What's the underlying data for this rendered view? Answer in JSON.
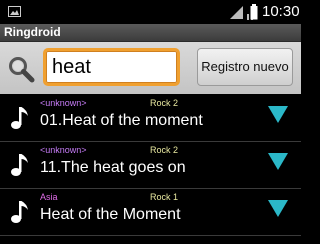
{
  "status_bar": {
    "time": "10:30",
    "icons": [
      "image-icon",
      "wifi-icon",
      "signal-icon",
      "battery-icon"
    ]
  },
  "app": {
    "title": "Ringdroid"
  },
  "search": {
    "value": "heat",
    "icon": "search-icon"
  },
  "buttons": {
    "new_label": "Registro nuevo"
  },
  "colors": {
    "artist_unknown": "#c67cf7",
    "artist_known": "#e06ce8",
    "album": "#e8e8a0",
    "menu_triangle": "#2bb8c8",
    "search_focus": "#f0a030"
  },
  "rows": [
    {
      "artist": "<unknown>",
      "album": "Rock 2",
      "title": "01.Heat of the moment"
    },
    {
      "artist": "<unknown>",
      "album": "Rock 2",
      "title": "11.The heat goes on"
    },
    {
      "artist": "Asia",
      "album": "Rock 1",
      "title": "Heat of the Moment"
    }
  ]
}
